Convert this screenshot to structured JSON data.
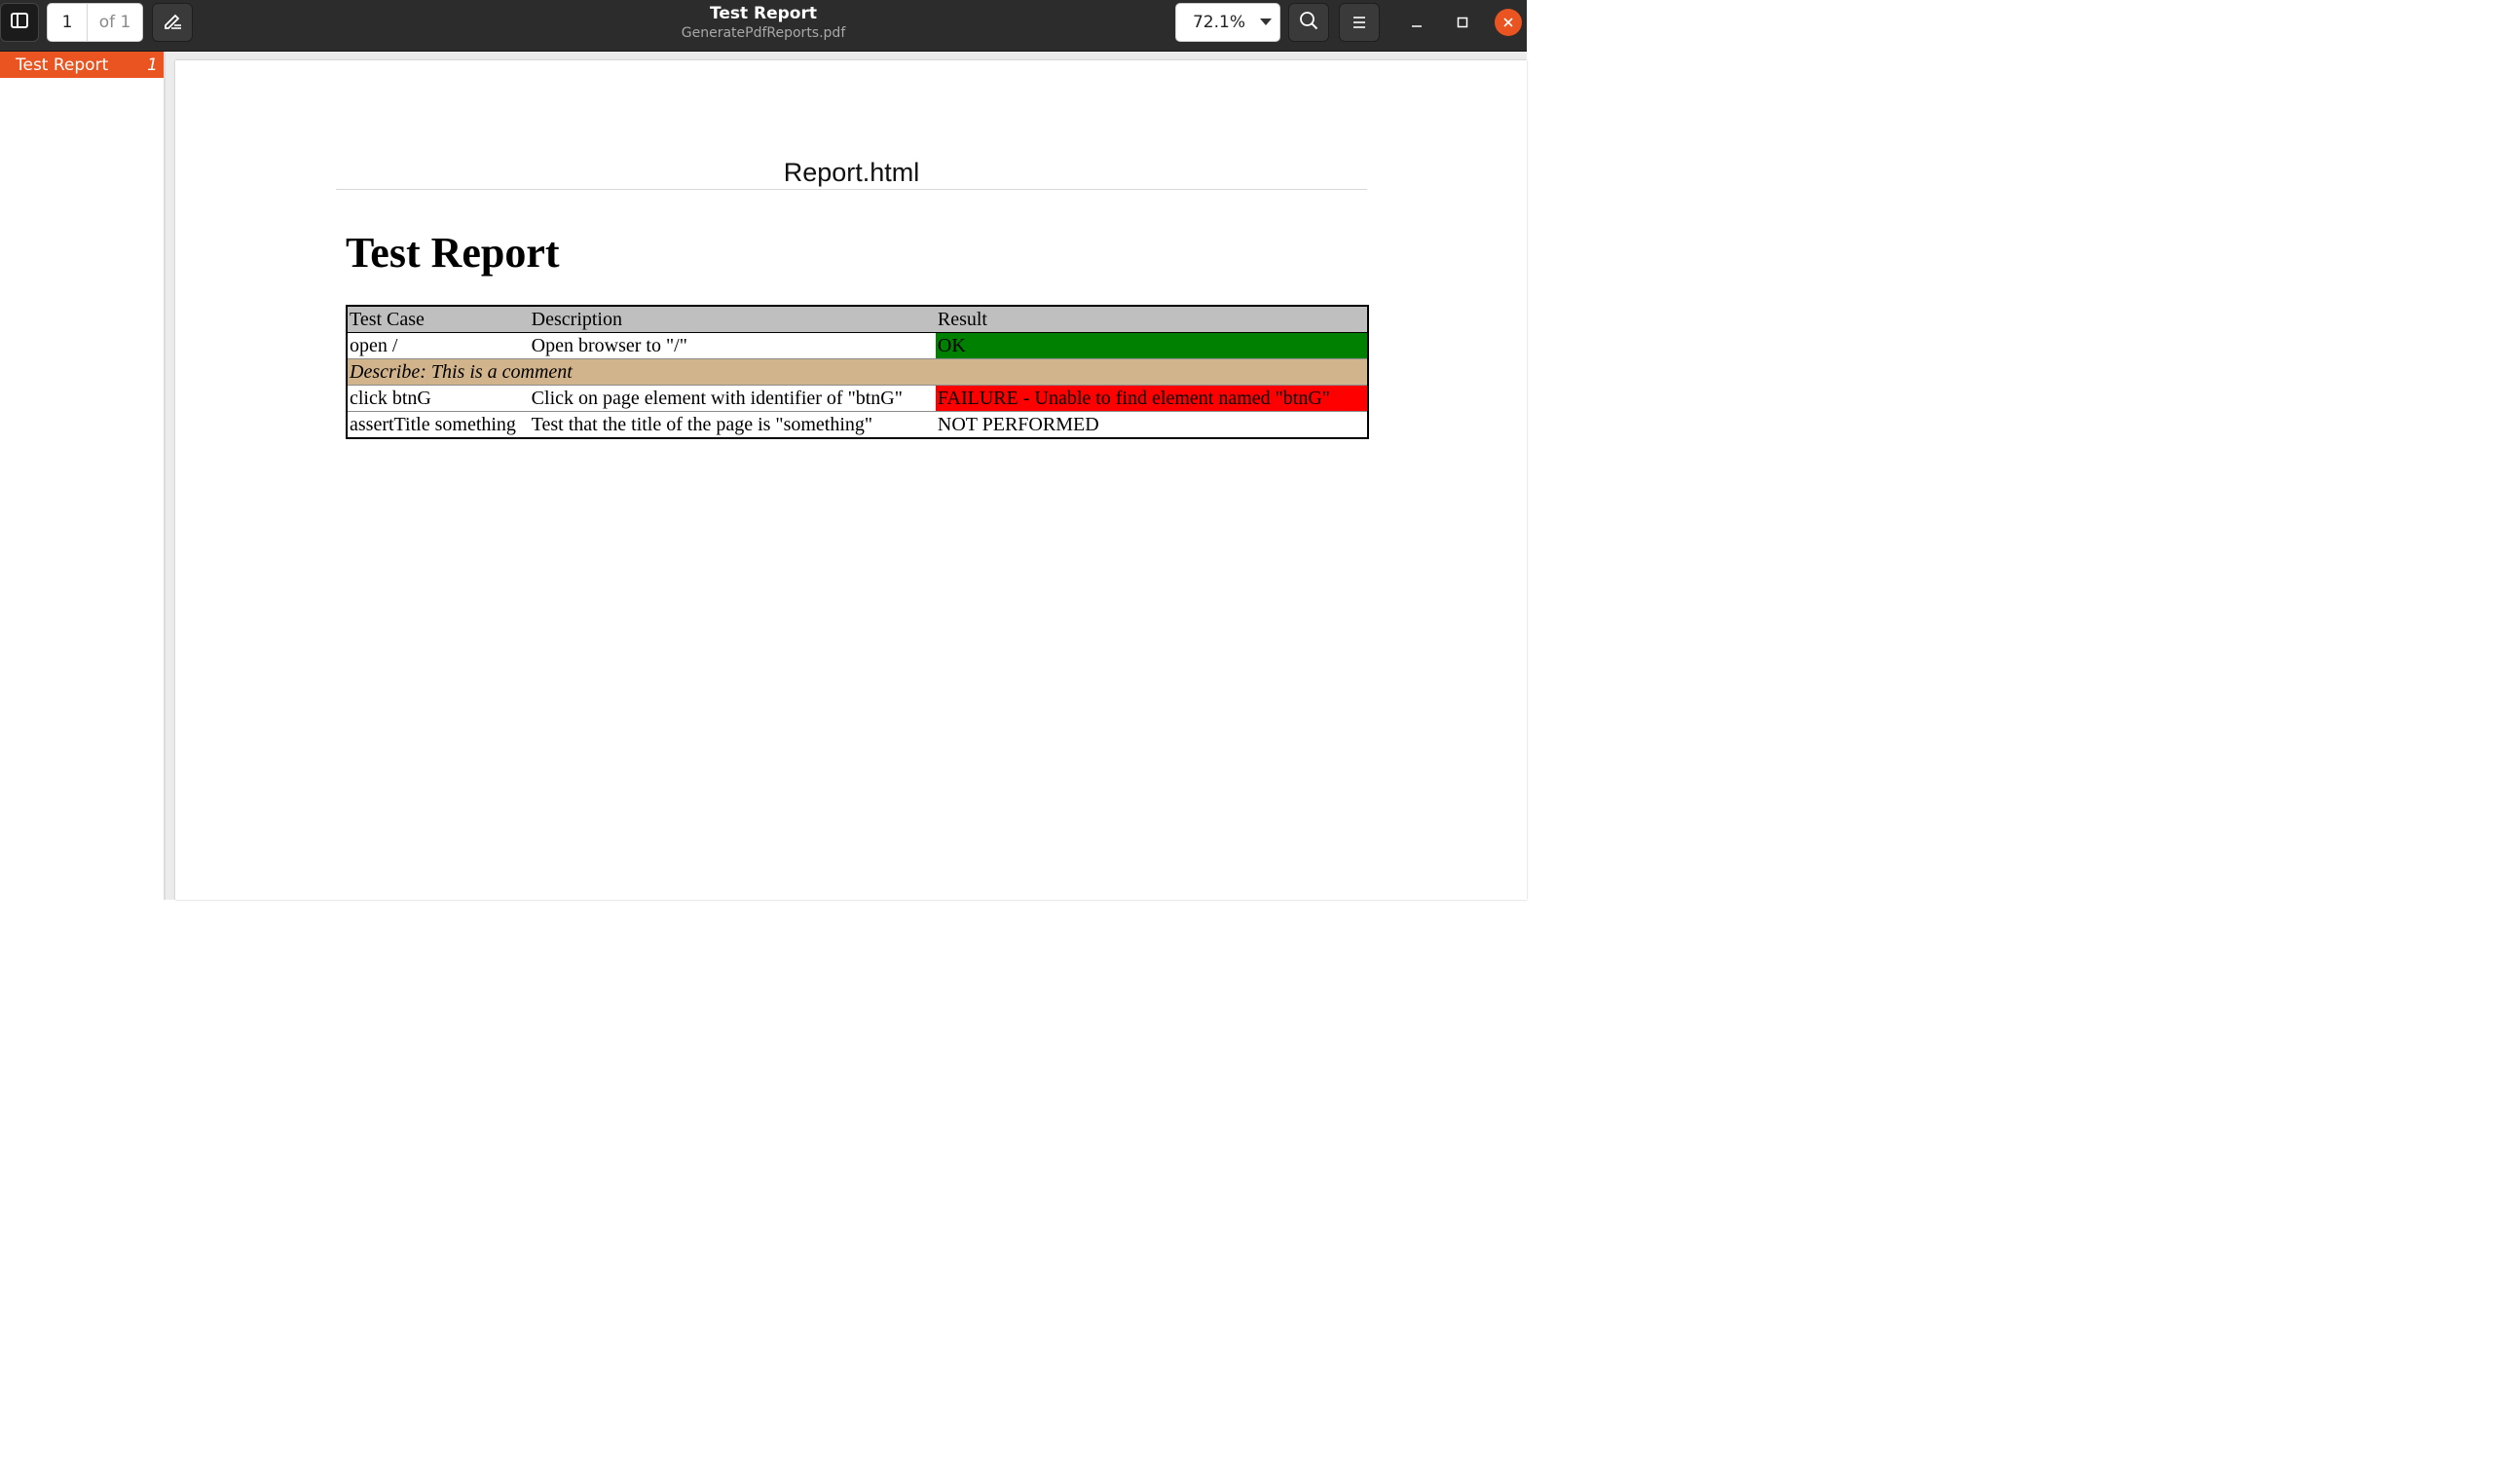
{
  "window": {
    "title": "Test Report",
    "subtitle": "GeneratePdfReports.pdf"
  },
  "toolbar": {
    "page_current": "1",
    "page_total": "of 1",
    "zoom": "72.1%"
  },
  "sidebar": {
    "outline": [
      {
        "label": "Test Report",
        "page": "1"
      }
    ]
  },
  "document": {
    "header": "Report.html",
    "heading": "Test Report",
    "table": {
      "columns": [
        "Test Case",
        "Description",
        "Result"
      ],
      "rows": [
        {
          "test_case": "open /",
          "description": "Open browser to \"/\"",
          "result": "OK",
          "status": "ok"
        },
        {
          "comment": "Describe: This is a comment"
        },
        {
          "test_case": "click btnG",
          "description": "Click on page element with identifier of \"btnG\"",
          "result": "FAILURE - Unable to find element named \"btnG\"",
          "status": "failure"
        },
        {
          "test_case": "assertTitle something",
          "description": "Test that the title of the page is \"something\"",
          "result": "NOT PERFORMED",
          "status": "not-performed"
        }
      ]
    }
  },
  "colors": {
    "accent": "#e95420",
    "ok": "#008000",
    "failure": "#ff0000",
    "comment": "#d2b48c",
    "table_header": "#bfbfbf"
  },
  "icons": [
    "sidebar-toggle-icon",
    "annotate-pencil-icon",
    "chevron-down-icon",
    "search-icon",
    "hamburger-menu-icon",
    "minimize-icon",
    "maximize-icon",
    "close-icon"
  ]
}
